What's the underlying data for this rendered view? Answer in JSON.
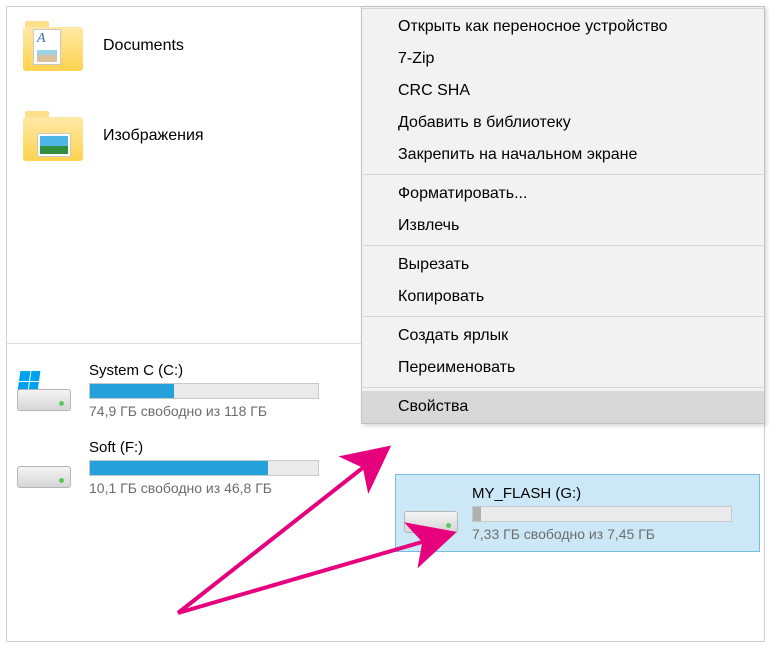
{
  "folders": [
    {
      "name": "Documents",
      "icon_type": "documents"
    },
    {
      "name": "Изображения",
      "icon_type": "images"
    }
  ],
  "drives": [
    {
      "name": "System C (C:)",
      "free_text": "74,9 ГБ свободно из 118 ГБ",
      "fill_pct": 37,
      "os": true
    },
    {
      "name": "Soft (F:)",
      "free_text": "10,1 ГБ свободно из 46,8 ГБ",
      "fill_pct": 78,
      "os": false
    }
  ],
  "flash_drive": {
    "name": "MY_FLASH (G:)",
    "free_text": "7,33 ГБ свободно из 7,45 ГБ",
    "fill_pct": 2
  },
  "context_menu": {
    "groups": [
      [
        "Открыть как переносное устройство",
        "7-Zip",
        "CRC SHA",
        "Добавить в библиотеку",
        "Закрепить на начальном экране"
      ],
      [
        "Форматировать...",
        "Извлечь"
      ],
      [
        "Вырезать",
        "Копировать"
      ],
      [
        "Создать ярлык",
        "Переименовать"
      ],
      [
        "Свойства"
      ]
    ],
    "highlighted": "Свойства"
  },
  "arrow_color": "#e6007e"
}
